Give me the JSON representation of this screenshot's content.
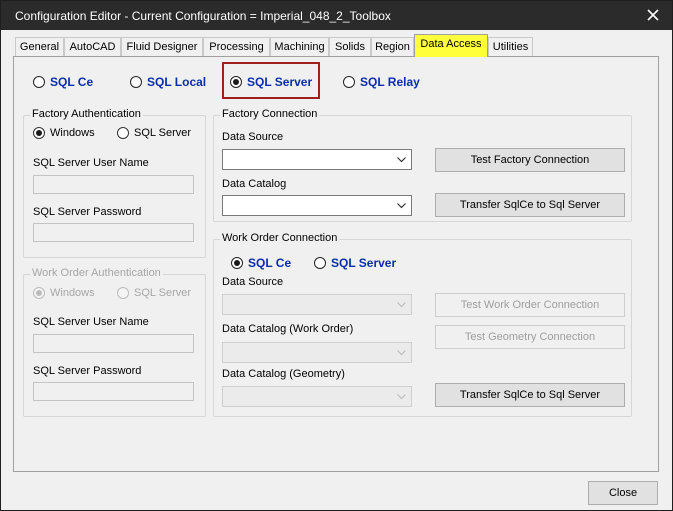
{
  "window": {
    "title": "Configuration Editor - Current Configuration = Imperial_048_2_Toolbox"
  },
  "tabs": [
    "General",
    "AutoCAD",
    "Fluid Designer",
    "Processing",
    "Machining",
    "Solids",
    "Region",
    "Data Access",
    "Utilities"
  ],
  "active_tab": "Data Access",
  "db_type": {
    "options": [
      "SQL Ce",
      "SQL Local",
      "SQL Server",
      "SQL Relay"
    ],
    "selected": "SQL Server"
  },
  "factory_auth": {
    "title": "Factory Authentication",
    "windows_label": "Windows",
    "sqlserver_label": "SQL Server",
    "selected": "Windows",
    "user_label": "SQL Server User Name",
    "user_value": "",
    "password_label": "SQL Server Password",
    "password_value": ""
  },
  "workorder_auth": {
    "title": "Work Order Authentication",
    "windows_label": "Windows",
    "sqlserver_label": "SQL Server",
    "selected": "Windows",
    "user_label": "SQL Server User Name",
    "user_value": "",
    "password_label": "SQL Server Password",
    "password_value": ""
  },
  "factory_conn": {
    "title": "Factory Connection",
    "datasource_label": "Data Source",
    "datasource_value": "",
    "catalog_label": "Data Catalog",
    "catalog_value": "",
    "test_button": "Test Factory Connection",
    "transfer_button": "Transfer SqlCe to Sql Server"
  },
  "workorder_conn": {
    "title": "Work Order Connection",
    "sqlce_label": "SQL Ce",
    "sqlserver_label": "SQL Server",
    "selected": "SQL Ce",
    "datasource_label": "Data Source",
    "catalog_wo_label": "Data Catalog (Work Order)",
    "catalog_geo_label": "Data Catalog (Geometry)",
    "test_wo_button": "Test Work Order Connection",
    "test_geo_button": "Test Geometry Connection",
    "transfer_button": "Transfer SqlCe to Sql Server"
  },
  "footer": {
    "close_button": "Close"
  }
}
